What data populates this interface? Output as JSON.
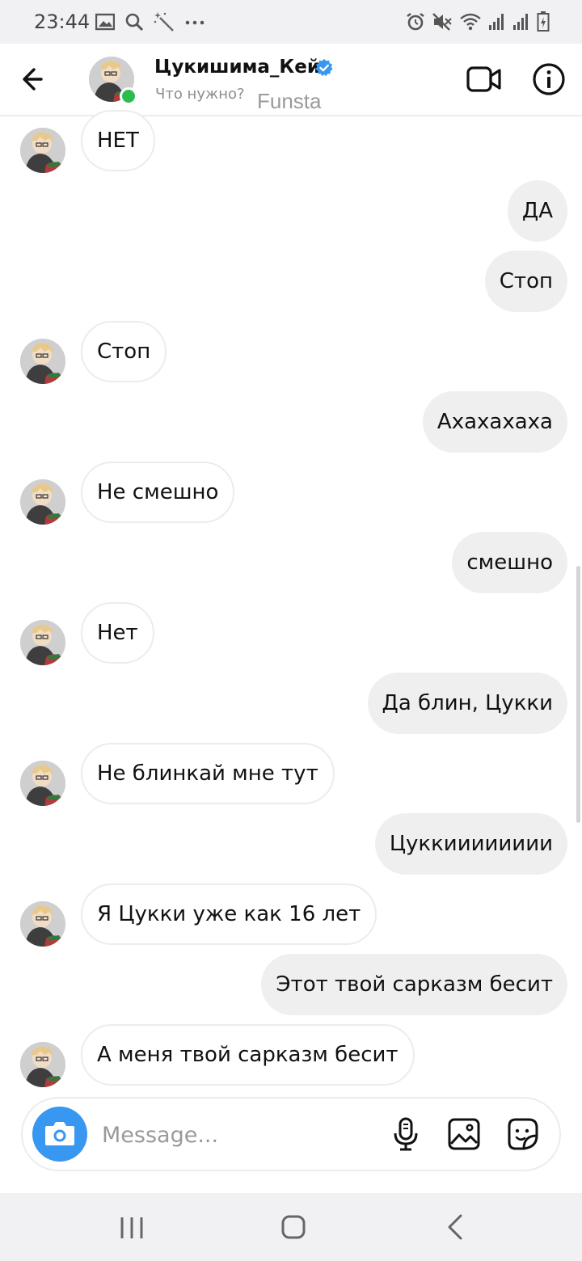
{
  "status_bar": {
    "time": "23:44",
    "left_icons": [
      "image-icon",
      "search-icon",
      "magic-wand-icon",
      "more-dots-icon"
    ],
    "right_icons": [
      "alarm-icon",
      "mute-icon",
      "wifi-icon",
      "signal-icon",
      "signal-icon",
      "battery-icon"
    ]
  },
  "header": {
    "contact_name": "Цукишима_Кей",
    "verified": true,
    "status_text": "Что нужно?",
    "tag_text": "Funsta",
    "online": true
  },
  "messages": [
    {
      "side": "in",
      "text": "НЕТ"
    },
    {
      "side": "out",
      "text": "ДА"
    },
    {
      "side": "out",
      "text": "Стоп"
    },
    {
      "side": "in",
      "text": "Стоп"
    },
    {
      "side": "out",
      "text": "Ахахахаха"
    },
    {
      "side": "in",
      "text": "Не смешно"
    },
    {
      "side": "out",
      "text": "смешно"
    },
    {
      "side": "in",
      "text": "Нет"
    },
    {
      "side": "out",
      "text": "Да блин, Цукки"
    },
    {
      "side": "in",
      "text": "Не блинкай мне тут"
    },
    {
      "side": "out",
      "text": "Цуккииииииии"
    },
    {
      "side": "in",
      "text": "Я Цукки уже как 16 лет"
    },
    {
      "side": "out",
      "text": "Этот твой сарказм бесит"
    },
    {
      "side": "in",
      "text": "А меня твой сарказм бесит"
    }
  ],
  "composer": {
    "placeholder": "Message...",
    "value": ""
  },
  "colors": {
    "accent": "#3897f0",
    "online": "#2dbb4e",
    "verified": "#3897f0",
    "outgoing_bubble": "#efefef",
    "incoming_border": "#ececec"
  }
}
